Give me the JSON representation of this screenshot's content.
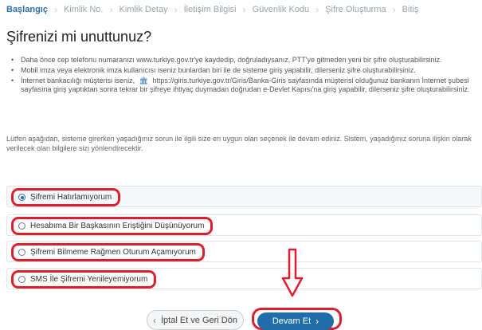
{
  "breadcrumb": {
    "steps": [
      "Başlangıç",
      "Kimlik No.",
      "Kimlik Detay",
      "İletişim Bilgisi",
      "Güvenlik Kodu",
      "Şifre Oluşturma",
      "Bitiş"
    ]
  },
  "page": {
    "title": "Şifrenizi mi unuttunuz?"
  },
  "bullets": [
    "Daha önce cep telefonu numaranızı www.turkiye.gov.tr'ye kaydedip, doğruladıysanız, PTT'ye gitmeden yeni bir şifre oluşturabilirsiniz.",
    "Mobil imza veya elektronik imza kullanıcısı iseniz bunlardan biri ile de sisteme giriş yapabilir, dilerseniz şifre oluşturabilirsiniz.",
    {
      "before": "İnternet bankacılığı müşterisi iseniz,",
      "link": "https://giris.turkiye.gov.tr/Giris/Banka-Giris",
      "after": "sayfasında müşterisi olduğunuz bankanın İnternet şubesi sayfasına giriş yaptıktan sonra tekrar bir şifreye ihtiyaç duymadan doğrudan e-Devlet Kapısı'na giriş yapabilir, dilerseniz şifre oluşturabilirsiniz."
    }
  ],
  "info_text": "Lütfen aşağıdan, sisteme girerken yaşadığınız sorun ile ilgili size en uygun olan seçenek ile devam ediniz. Sistem, yaşadığınız soruna ilişkin olarak verilecek olan bilgilere sizi yönlendirecektir.",
  "options": [
    {
      "label": "Şifremi Hatırlamıyorum",
      "selected": true
    },
    {
      "label": "Hesabıma Bir Başkasının Eriştiğini Düşünüyorum",
      "selected": false
    },
    {
      "label": "Şifremi Bilmeme Rağmen Oturum Açamıyorum",
      "selected": false
    },
    {
      "label": "SMS İle Şifremi Yenileyemiyorum",
      "selected": false
    }
  ],
  "buttons": {
    "cancel": "İptal Et ve Geri Dön",
    "continue": "Devam Et"
  },
  "icons": {
    "bank": "bank-icon",
    "arrow": "down-arrow-annotation-icon"
  },
  "colors": {
    "accent": "#1f6ea9",
    "highlight": "#dd1f2d",
    "breadcrumb_active": "#2b6fae"
  }
}
